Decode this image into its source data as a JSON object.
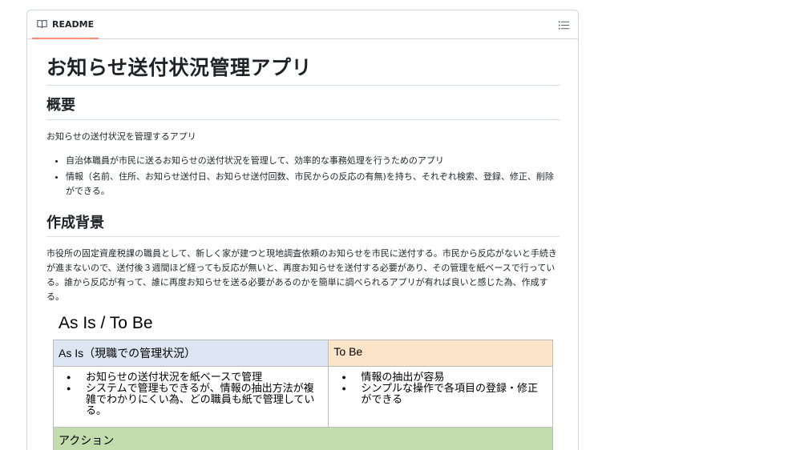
{
  "readme": {
    "tab_label": "README"
  },
  "doc": {
    "title": "お知らせ送付状況管理アプリ",
    "overview": {
      "heading": "概要",
      "intro": "お知らせの送付状況を管理するアプリ",
      "bullets": [
        "自治体職員が市民に送るお知らせの送付状況を管理して、効率的な事務処理を行うためのアプリ",
        "情報（名前、住所、お知らせ送付日、お知らせ送付回数、市民からの反応の有無)を持ち、それぞれ検索、登録、修正、削除ができる。"
      ]
    },
    "background": {
      "heading": "作成背景",
      "paragraph": "市役所の固定資産税課の職員として、新しく家が建つと現地調査依頼のお知らせを市民に送付する。市民から反応がないと手続きが進まないので、送付後３週間ほど経っても反応が無いと、再度お知らせを送付する必要があり、その管理を紙ベースで行っている。誰から反応が有って、誰に再度お知らせを送る必要があるのかを簡単に調べられるアプリが有れば良いと感じた為、作成する。"
    },
    "asis_tobe": {
      "heading": "As Is / To Be",
      "asis_header": "As Is（現職での管理状況）",
      "tobe_header": "To Be",
      "asis_items": [
        "お知らせの送付状況を紙ベースで管理",
        "システムで管理もできるが、情報の抽出方法が複雑でわかりにくい為、どの職員も紙で管理している。"
      ],
      "tobe_items": [
        "情報の抽出が容易",
        "シンプルな操作で各項目の登録・修正ができる"
      ],
      "action_header": "アクション"
    }
  }
}
